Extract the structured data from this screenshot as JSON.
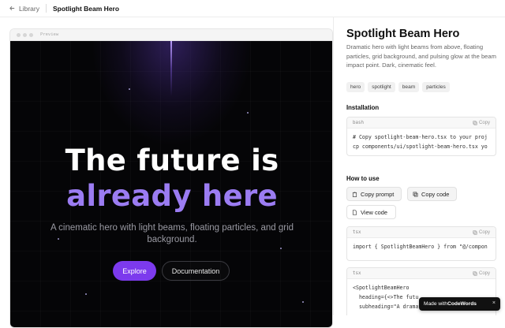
{
  "topbar": {
    "back_label": "Library",
    "title": "Spotlight Beam Hero"
  },
  "preview": {
    "label": "Preview",
    "heading_line1": "The future is",
    "heading_line2": "already here",
    "subheading": "A cinematic hero with light beams, floating particles, and grid background.",
    "primary_button": "Explore",
    "secondary_button": "Documentation",
    "accent_color": "#7c3aed",
    "highlight_color": "#9b7cf2"
  },
  "sidebar": {
    "title": "Spotlight Beam Hero",
    "description": "Dramatic hero with light beams from above, floating particles, grid background, and pulsing glow at the beam impact point. Dark, cinematic feel.",
    "tags": [
      "hero",
      "spotlight",
      "beam",
      "particles"
    ],
    "installation_heading": "Installation",
    "install_block": {
      "lang": "bash",
      "copy_label": "Copy",
      "lines": [
        "# Copy spotlight-beam-hero.tsx to your proj",
        "cp components/ui/spotlight-beam-hero.tsx yo"
      ]
    },
    "howto_heading": "How to use",
    "actions": {
      "copy_prompt": "Copy prompt",
      "copy_code": "Copy code",
      "view_code": "View code"
    },
    "import_block": {
      "lang": "tsx",
      "copy_label": "Copy",
      "lines": [
        "import { SpotlightBeamHero } from \"@/compon"
      ]
    },
    "usage_block": {
      "lang": "tsx",
      "copy_label": "Copy",
      "lines": [
        "<SpotlightBeamHero",
        "  heading={<>The futu",
        "  subheading=\"A dramat"
      ]
    }
  },
  "toast": {
    "prefix": "Made with ",
    "brand": "CodeWords",
    "close": "×"
  }
}
